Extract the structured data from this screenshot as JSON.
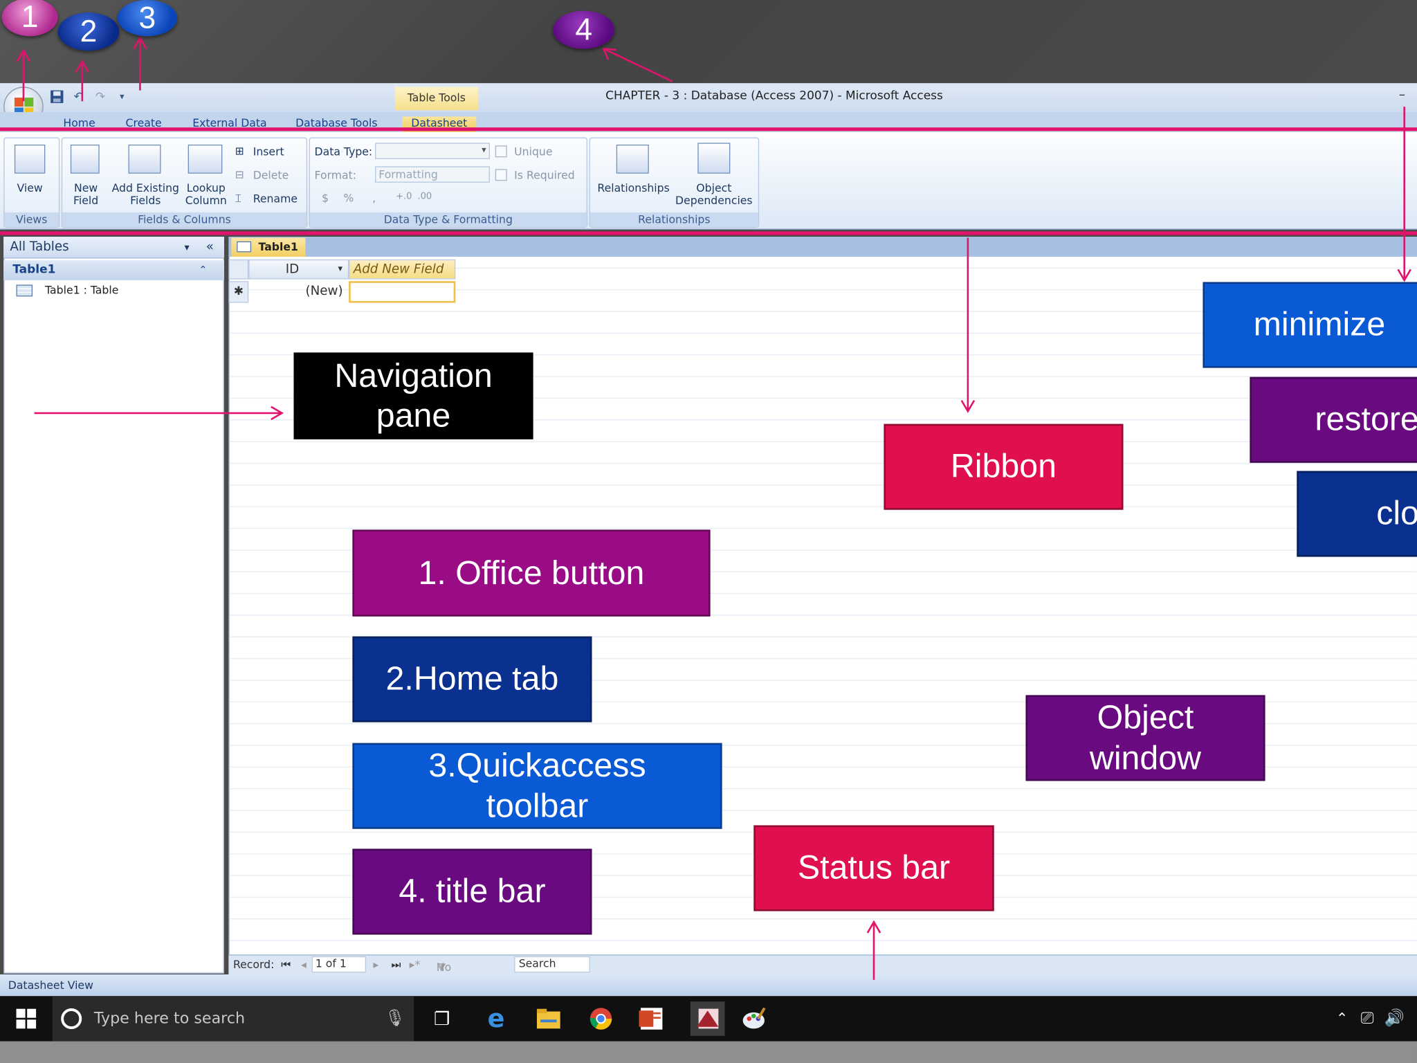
{
  "window": {
    "title": "CHAPTER - 3 : Database (Access 2007) - Microsoft Access",
    "context_tab_title": "Table Tools"
  },
  "tabs": [
    "Home",
    "Create",
    "External Data",
    "Database Tools",
    "Datasheet"
  ],
  "ribbon": {
    "views": {
      "view_label": "View",
      "group": "Views"
    },
    "fields_columns": {
      "new_field": "New\nField",
      "add_existing": "Add Existing\nFields",
      "lookup": "Lookup\nColumn",
      "insert": "Insert",
      "delete": "Delete",
      "rename": "Rename",
      "group": "Fields & Columns"
    },
    "data_type": {
      "data_type_label": "Data Type:",
      "format_label": "Format:",
      "format_value": "Formatting",
      "unique": "Unique",
      "is_required": "Is Required",
      "dollar": "$",
      "percent": "%",
      "comma": ",",
      "inc_dec": "+.0",
      "dec_dec": ".00",
      "group": "Data Type & Formatting"
    },
    "relationships": {
      "relationships": "Relationships",
      "object_dependencies": "Object\nDependencies",
      "group": "Relationships"
    }
  },
  "nav": {
    "header": "All Tables",
    "group": "Table1",
    "item": "Table1 : Table"
  },
  "datasheet": {
    "tab": "Table1",
    "col_id": "ID",
    "col_add": "Add New Field",
    "new_row_marker": "✱",
    "new_cell": "(New)"
  },
  "record_nav": {
    "record_label": "Record:",
    "position": "1 of 1",
    "no_filter": "No Filter",
    "search": "Search"
  },
  "status": {
    "text": "Datasheet View"
  },
  "taskbar": {
    "search_placeholder": "Type here to search"
  },
  "badges": [
    "1",
    "2",
    "3",
    "4"
  ],
  "labels": {
    "navigation_pane": "Navigation\npane",
    "ribbon": "Ribbon",
    "minimize": "minimize",
    "restore": "restore",
    "close": "clo",
    "office_button": "1. Office button",
    "home_tab": "2.Home tab",
    "quick_access": "3.Quickaccess\ntoolbar",
    "title_bar": "4. title bar",
    "object_window": "Object\nwindow",
    "status_bar": "Status bar"
  },
  "colors": {
    "accent_pink": "#e0146c",
    "label_purple": "#6a0a80",
    "label_magenta": "#9a0c86",
    "label_navy": "#0a3090",
    "label_blue": "#0a5ad6",
    "label_red": "#e0104e"
  }
}
